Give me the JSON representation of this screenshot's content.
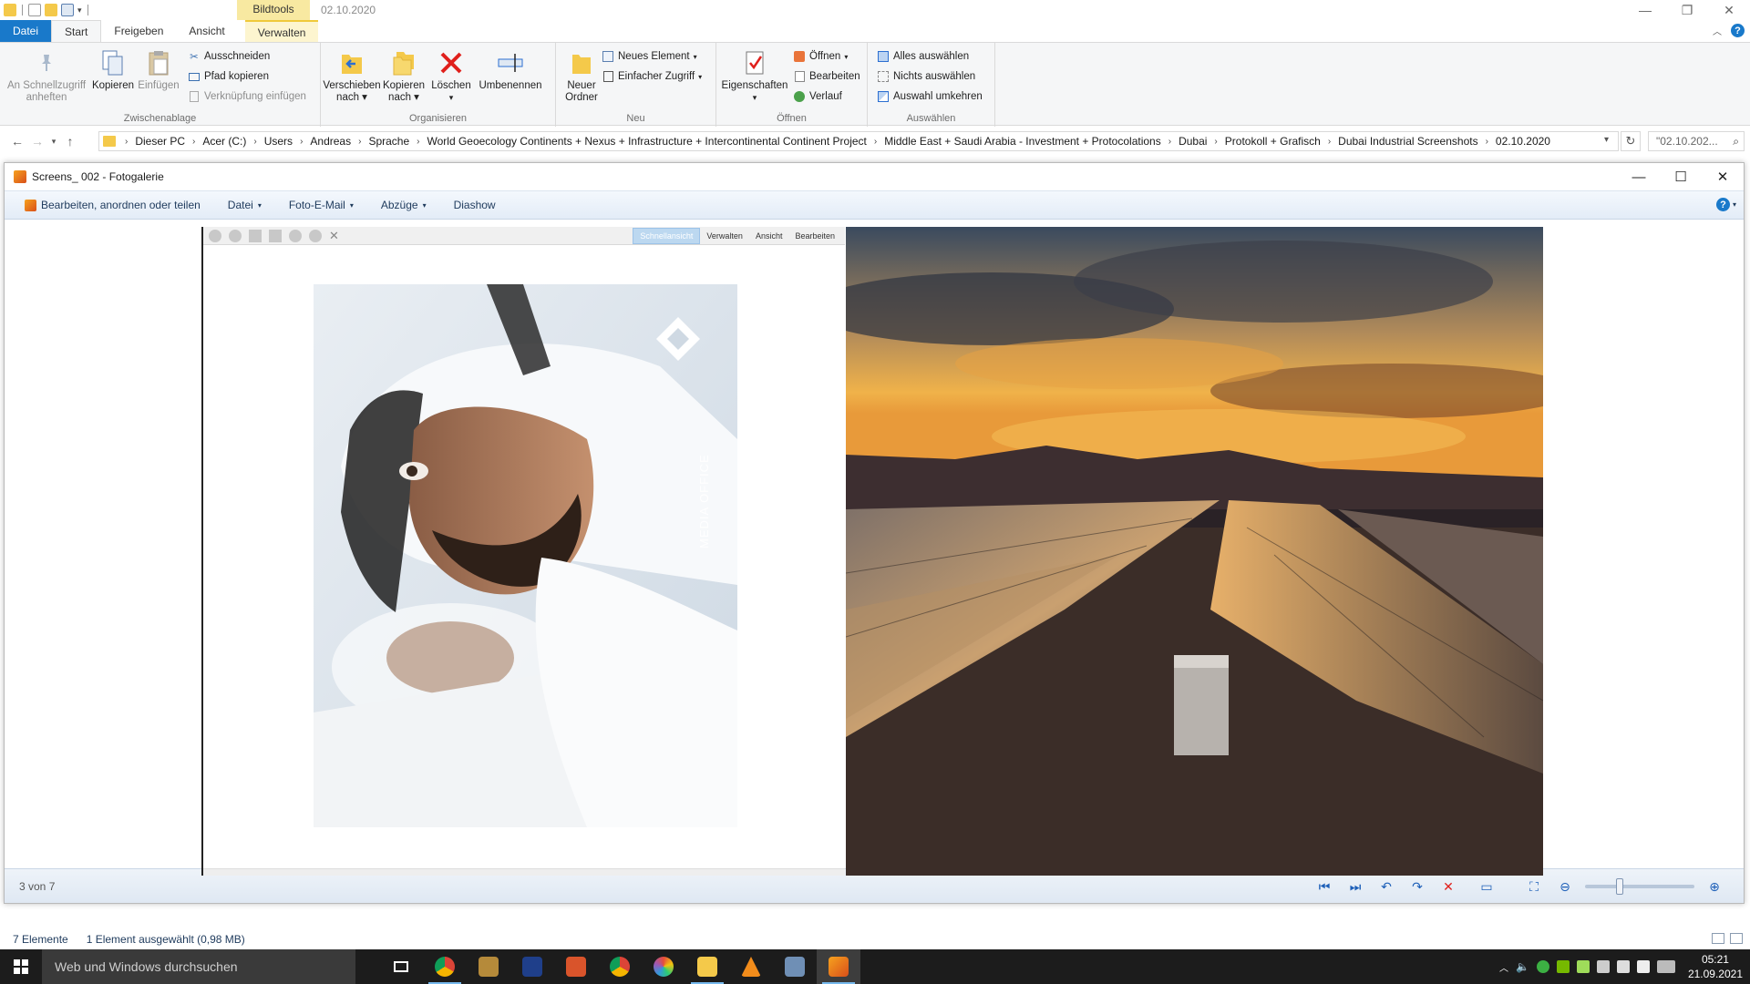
{
  "titlebar": {
    "context_group": "Bildtools",
    "title": "02.10.2020",
    "minimize_icon": "minimize-icon",
    "maximize_icon": "maximize-icon",
    "close_icon": "close-icon"
  },
  "ribbon_tabs": [
    {
      "label": "Datei"
    },
    {
      "label": "Start"
    },
    {
      "label": "Freigeben"
    },
    {
      "label": "Ansicht"
    },
    {
      "label": "Verwalten"
    }
  ],
  "ribbon": {
    "clipboard": {
      "label": "Zwischenablage",
      "pin": "An Schnellzugriff anheften",
      "pin_line1": "An Schnellzugriff",
      "pin_line2": "anheften",
      "copy": "Kopieren",
      "paste": "Einfügen",
      "cut": "Ausschneiden",
      "copy_path": "Pfad kopieren",
      "paste_shortcut": "Verknüpfung einfügen"
    },
    "organize": {
      "label": "Organisieren",
      "move_line1": "Verschieben",
      "move_line2": "nach",
      "copy_line1": "Kopieren",
      "copy_line2": "nach",
      "delete": "Löschen",
      "rename": "Umbenennen"
    },
    "new": {
      "label": "Neu",
      "new_folder_line1": "Neuer",
      "new_folder_line2": "Ordner",
      "new_item": "Neues Element",
      "easy_access": "Einfacher Zugriff"
    },
    "open": {
      "label": "Öffnen",
      "properties": "Eigenschaften",
      "open": "Öffnen",
      "edit": "Bearbeiten",
      "history": "Verlauf"
    },
    "select": {
      "label": "Auswählen",
      "select_all": "Alles auswählen",
      "select_none": "Nichts auswählen",
      "invert": "Auswahl umkehren"
    }
  },
  "address": {
    "crumbs": [
      "Dieser PC",
      "Acer (C:)",
      "Users",
      "Andreas",
      "Sprache",
      "World Geoecology Continents + Nexus + Infrastructure + Intercontinental Continent Project",
      "Middle East + Saudi Arabia - Investment + Protocolations",
      "Dubai",
      "Protokoll + Grafisch",
      "Dubai Industrial Screenshots",
      "02.10.2020"
    ],
    "search_placeholder": "\"02.10.202..."
  },
  "gallery": {
    "title": "Screens_ 002 - Fotogalerie",
    "menu": [
      {
        "label": "Bearbeiten, anordnen oder teilen"
      },
      {
        "label": "Datei"
      },
      {
        "label": "Foto-E-Mail"
      },
      {
        "label": "Abzüge"
      },
      {
        "label": "Diashow"
      }
    ],
    "counter": "3 von 7",
    "inner_tabs": [
      "Schnellansicht",
      "Verwalten",
      "Ansicht",
      "Bearbeiten"
    ],
    "logo_text": "MEDIA OFFICE",
    "zoom_fraction": 0.3
  },
  "explorer_status": {
    "items": "7 Elemente",
    "selected": "1 Element ausgewählt (0,98 MB)"
  },
  "taskbar": {
    "search_placeholder": "Web und Windows durchsuchen",
    "time": "05:21",
    "date": "21.09.2021"
  },
  "colors": {
    "accent": "#1979ca",
    "context_tab": "#f8e9a1",
    "taskbar": "#1c1c1c"
  }
}
